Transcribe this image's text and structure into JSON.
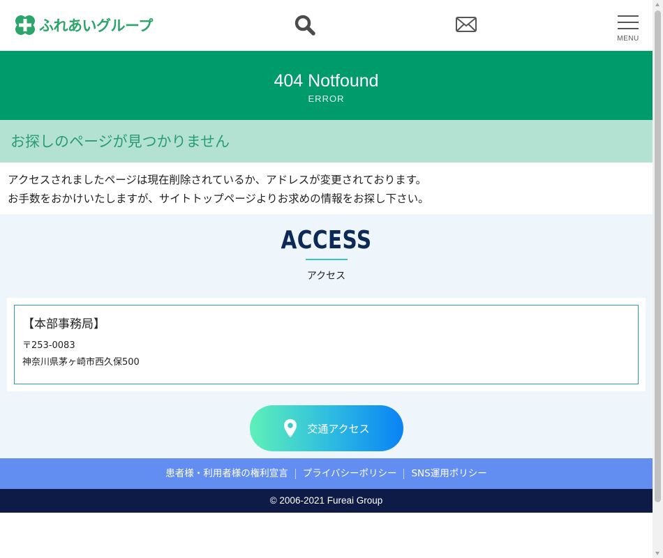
{
  "header": {
    "logo_text": "ふれあいグループ",
    "search_icon": "search-icon",
    "mail_icon": "mail-icon",
    "menu_label": "MENU",
    "brand_color": "#2ca56a"
  },
  "title_band": {
    "title": "404 Notfound",
    "subtitle": "ERROR",
    "bg_color": "#009b6b"
  },
  "error": {
    "heading": "お探しのページが見つかりません",
    "lines": [
      "アクセスされましたページは現在削除されているか、アドレスが変更されております。",
      "お手数をおかけいたしますが、サイトトップページよりお求めの情報をお探し下さい。"
    ]
  },
  "access": {
    "title": "ACCESS",
    "subtitle": "アクセス",
    "office_title": "【本部事務局】",
    "postal": "〒253-0083",
    "address": "神奈川県茅ヶ崎市西久保500",
    "button_label": "交通アクセス",
    "button_icon": "map-pin-icon"
  },
  "footer": {
    "links": [
      "患者様・利用者様の権利宣言",
      "プライバシーポリシー",
      "SNS運用ポリシー"
    ],
    "copyright": "© 2006-2021 Fureai Group"
  }
}
